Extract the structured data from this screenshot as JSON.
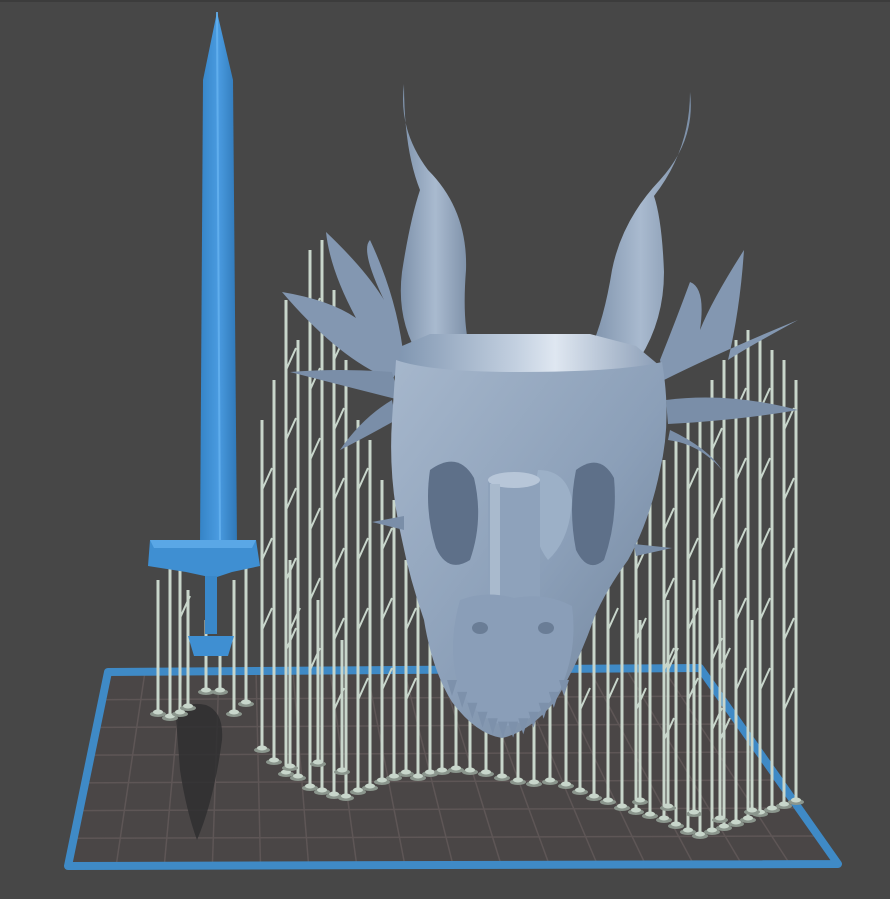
{
  "viewport": {
    "background": "#474747",
    "plate_border_color": "#3f8ac6",
    "plate_fill_color": "#4a4646",
    "grid_line_color": "#5e5656",
    "support_color": "#c8d6cb",
    "support_shadow_color": "#8b968d",
    "selected_model_color": "#3f8fd2",
    "model_color": "#8fa3bc",
    "model_shade_color": "#6b7d95",
    "shadow_color": "#2f2f30"
  },
  "models": [
    {
      "name": "sword",
      "selected": true
    },
    {
      "name": "dragon-skull",
      "selected": false
    }
  ]
}
